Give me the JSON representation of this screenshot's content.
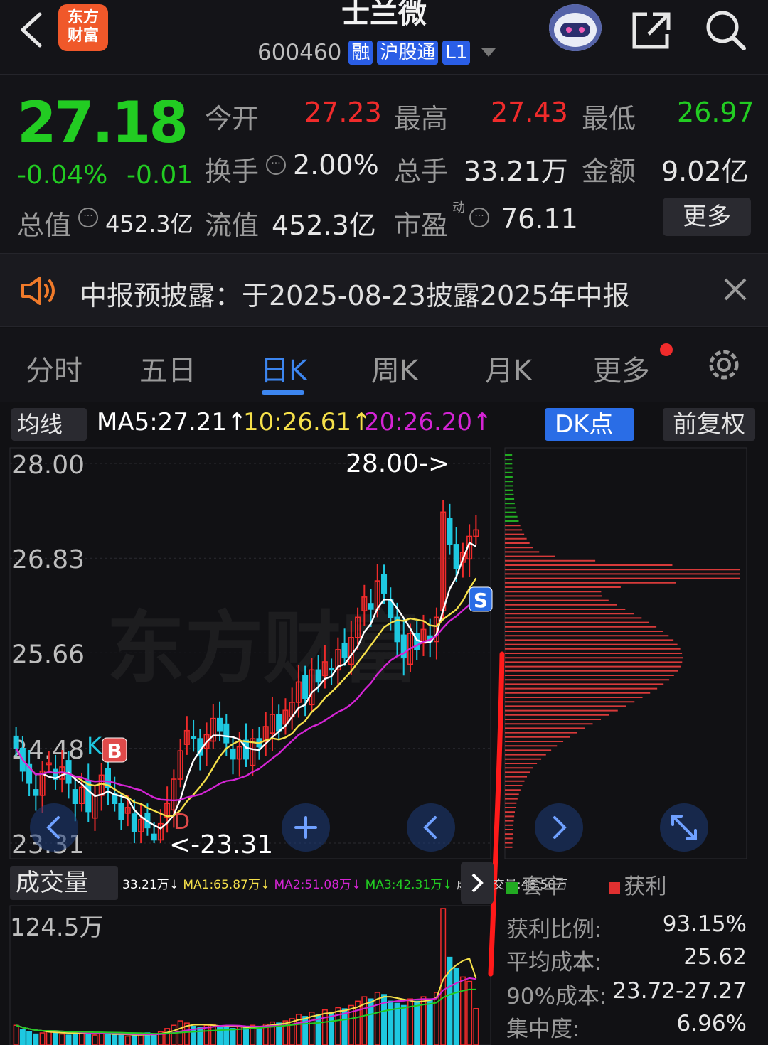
{
  "header": {
    "app_logo_line1": "东方",
    "app_logo_line2": "财富",
    "stock_name": "士兰微",
    "stock_code": "600460",
    "tags": [
      "融",
      "沪股通",
      "L1"
    ]
  },
  "quote": {
    "last_price": "27.18",
    "change_pct": "-0.04%",
    "change_abs": "-0.01",
    "open_label": "今开",
    "open": "27.23",
    "high_label": "最高",
    "high": "27.43",
    "low_label": "最低",
    "low": "26.97",
    "turnover_label": "换手",
    "turnover": "2.00%",
    "volume_label": "总手",
    "volume": "33.21万",
    "amount_label": "金额",
    "amount": "9.02亿",
    "total_mv_label": "总值",
    "total_mv": "452.3亿",
    "float_mv_label": "流值",
    "float_mv": "452.3亿",
    "pe_label": "市盈",
    "pe_sup": "动",
    "pe": "76.11",
    "more_label": "更多"
  },
  "notice": {
    "text": "中报预披露：于2025-08-23披露2025年中报"
  },
  "tabs": [
    "分时",
    "五日",
    "日K",
    "周K",
    "月K",
    "更多"
  ],
  "active_tab": "日K",
  "ma_bar": {
    "select_label": "均线",
    "ma5": "MA5:27.21↑",
    "ma10": "10:26.61↑",
    "ma20": "20:26.20↑",
    "dk_label": "DK点",
    "fq_label": "前复权"
  },
  "colors": {
    "up": "#f02b2b",
    "down": "#22cc22",
    "accent": "#3d86f0",
    "ma5": "#ffffff",
    "ma10": "#f5e04a",
    "ma20": "#d424d4"
  },
  "kline": {
    "y_ticks": [
      "28.00",
      "26.83",
      "25.66",
      "24.48",
      "23.31"
    ],
    "high_marker": "28.00->",
    "low_marker": "<-23.31",
    "watermark": "东方财富",
    "buy_marker": "B",
    "sell_marker": "S",
    "k_marker": "K",
    "d_marker": "D"
  },
  "volume": {
    "select_label": "成交量",
    "legend": [
      "33.21万↓",
      "MA1:65.87万↓",
      "MA2:51.08万↓",
      "MA3:42.31万↓",
      "虚拟成交量:46.58万"
    ],
    "max_label": "124.5万"
  },
  "cost": {
    "legend_trapped": "套牢",
    "legend_profit": "获利",
    "rows": [
      {
        "label": "获利比例:",
        "value": "93.15%"
      },
      {
        "label": "平均成本:",
        "value": "25.62"
      },
      {
        "label": "90%成本:",
        "value": "23.72-27.27"
      },
      {
        "label": "集中度:",
        "value": "6.96%"
      }
    ]
  },
  "chart_data": {
    "type": "candlestick",
    "y_axis_ticks": [
      28.0,
      26.83,
      25.66,
      24.48,
      23.31
    ],
    "ylim": [
      23.31,
      28.0
    ],
    "period_high": 28.0,
    "period_low": 23.31,
    "ma5_last": 27.21,
    "ma10_last": 26.61,
    "ma20_last": 26.2,
    "close_series": [
      24.48,
      24.2,
      24.05,
      23.9,
      24.2,
      24.3,
      24.1,
      24.25,
      24.05,
      23.8,
      24.0,
      23.7,
      23.9,
      24.15,
      24.0,
      23.8,
      23.6,
      23.75,
      23.45,
      23.6,
      23.5,
      23.35,
      23.55,
      23.8,
      24.1,
      24.45,
      24.7,
      24.6,
      24.4,
      24.65,
      24.85,
      24.7,
      24.55,
      24.35,
      24.5,
      24.35,
      24.6,
      24.5,
      24.75,
      24.9,
      24.7,
      24.95,
      25.05,
      25.3,
      25.1,
      25.45,
      25.3,
      25.55,
      25.45,
      25.7,
      25.6,
      25.85,
      26.1,
      26.35,
      26.2,
      26.55,
      26.4,
      26.1,
      25.8,
      25.6,
      25.9,
      25.7,
      25.95,
      25.8,
      26.1,
      27.4,
      27.0,
      26.7,
      26.9,
      27.1,
      27.18
    ],
    "volume_series": [
      18,
      14,
      12,
      10,
      11,
      13,
      12,
      10,
      9,
      11,
      12,
      10,
      9,
      11,
      10,
      9,
      10,
      8,
      9,
      10,
      11,
      9,
      12,
      15,
      18,
      22,
      20,
      17,
      16,
      18,
      19,
      17,
      16,
      15,
      17,
      16,
      18,
      17,
      19,
      21,
      20,
      22,
      24,
      28,
      26,
      30,
      28,
      32,
      30,
      34,
      33,
      36,
      40,
      44,
      42,
      48,
      46,
      40,
      38,
      36,
      42,
      40,
      44,
      42,
      48,
      124.5,
      80,
      70,
      62,
      58,
      33.21
    ],
    "volume_max": 124.5
  }
}
